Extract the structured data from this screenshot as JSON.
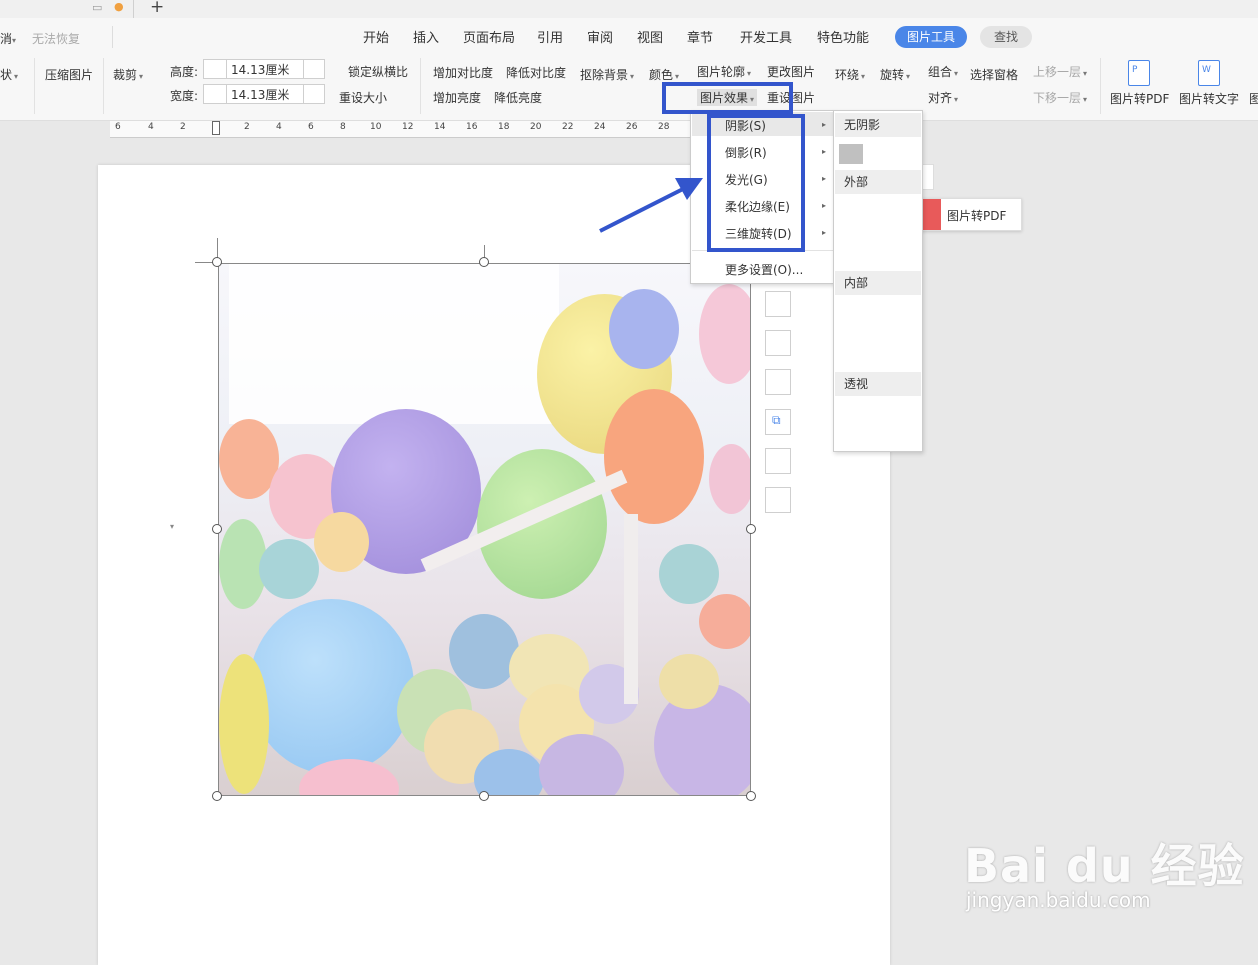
{
  "tabstrip": {
    "new_tab": "+"
  },
  "quick_access": {
    "undo_label": "消",
    "redo_label": "无法恢复"
  },
  "menu": {
    "items": [
      "开始",
      "插入",
      "页面布局",
      "引用",
      "审阅",
      "视图",
      "章节",
      "开发工具",
      "特色功能"
    ],
    "active": "图片工具",
    "find": "查找"
  },
  "ribbon": {
    "shape_label": "状",
    "compress": "压缩图片",
    "crop": "裁剪",
    "height_label": "高度:",
    "width_label": "宽度:",
    "height_value": "14.13厘米",
    "width_value": "14.13厘米",
    "lock_ratio": "锁定纵横比",
    "reset_size": "重设大小",
    "increase_contrast": "增加对比度",
    "decrease_contrast": "降低对比度",
    "increase_brightness": "增加亮度",
    "decrease_brightness": "降低亮度",
    "remove_bg": "抠除背景",
    "color": "颜色",
    "outline": "图片轮廓",
    "change_pic": "更改图片",
    "effects": "图片效果",
    "reset_pic": "重设图片",
    "wrap": "环绕",
    "rotate": "旋转",
    "group": "组合",
    "select_pane": "选择窗格",
    "align": "对齐",
    "bring_forward": "上移一层",
    "send_backward": "下移一层",
    "to_pdf": "图片转PDF",
    "to_text": "图片转文字",
    "last_cut": "图"
  },
  "ruler": [
    "6",
    "4",
    "2",
    "2",
    "4",
    "6",
    "8",
    "10",
    "12",
    "14",
    "16",
    "18",
    "20",
    "22",
    "24",
    "26",
    "28"
  ],
  "effects_menu": {
    "items": [
      "阴影(S)",
      "倒影(R)",
      "发光(G)",
      "柔化边缘(E)",
      "三维旋转(D)"
    ],
    "more": "更多设置(O)..."
  },
  "shadow_submenu": {
    "none": "无阴影",
    "outer": "外部",
    "inner": "内部",
    "perspective": "透视"
  },
  "tooltip": {
    "label": "图片转PDF"
  },
  "watermark": {
    "brand": "Bai du 经验",
    "url": "jingyan.baidu.com"
  },
  "colors": {
    "accent": "#4a86e8",
    "highlight": "#3355cc"
  }
}
